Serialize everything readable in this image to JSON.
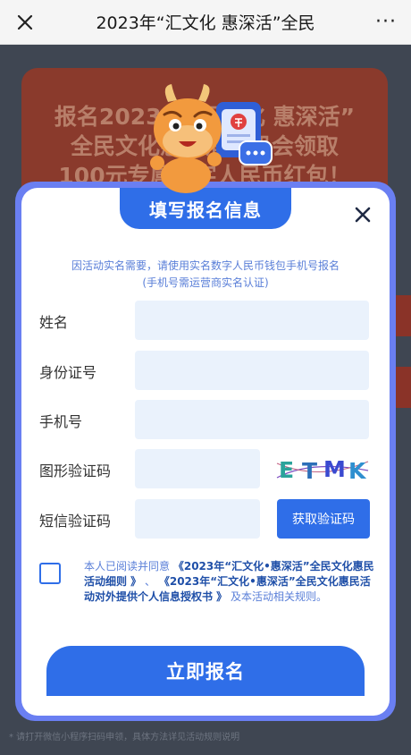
{
  "navbar": {
    "title": "2023年“汇文化 惠深活”全民",
    "more": "···"
  },
  "background": {
    "banner_text_line1": "报名2023年“汇文化 惠深活”",
    "banner_text_line2": "全民文化惠民消费机会领取",
    "banner_text_line3": "100元专属数字人民币红包！",
    "footer_text": "* 请打开微信小程序扫码申领，具体方法详见活动规则说明"
  },
  "modal": {
    "title": "填写报名信息",
    "notice_line1": "因活动实名需要，请使用实名数字人民币钱包手机号报名",
    "notice_line2": "(手机号需运营商实名认证)",
    "fields": {
      "name_label": "姓名",
      "id_label": "身份证号",
      "phone_label": "手机号",
      "captcha_label": "图形验证码",
      "sms_label": "短信验证码"
    },
    "captcha_text": "ETMK",
    "sms_button": "获取验证码",
    "agreement": {
      "prefix": "本人已阅读并同意",
      "doc1": "《2023年“汇文化•惠深活”全民文化惠民活动细则 》",
      "sep": "、",
      "doc2": "《2023年“汇文化•惠深活”全民文化惠民活动对外提供个人信息授权书 》",
      "suffix": "及本活动相关规则。"
    },
    "submit_button": "立即报名"
  },
  "colors": {
    "primary": "#2f6ee8",
    "frame": "#6a7ff2",
    "input_bg": "#eaf2fc",
    "notice_text": "#5a7fd8"
  }
}
